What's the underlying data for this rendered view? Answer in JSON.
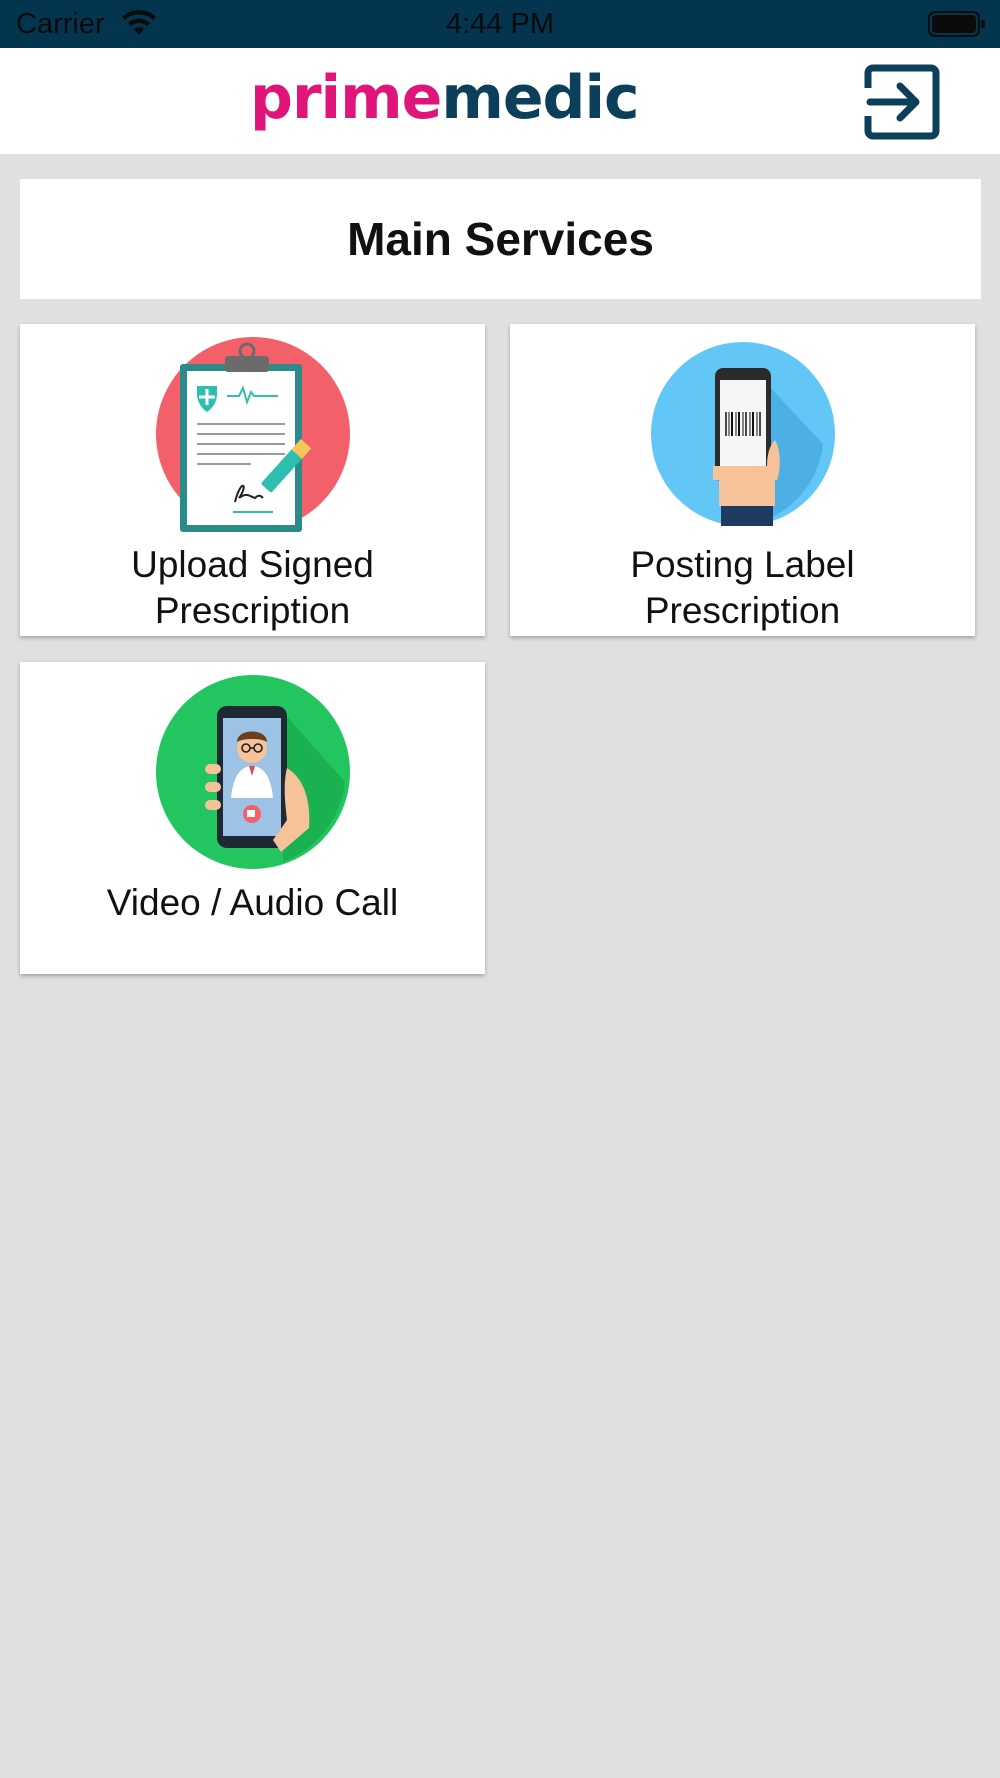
{
  "status_bar": {
    "carrier": "Carrier",
    "time": "4:44 PM",
    "wifi_icon": "wifi-icon",
    "battery_icon": "battery-icon"
  },
  "header": {
    "logo_prime": "prime",
    "logo_medic": "medic",
    "logout_icon": "logout-icon"
  },
  "main": {
    "title": "Main Services",
    "services": [
      {
        "label": "Upload Signed Prescription",
        "icon": "prescription-clipboard-icon",
        "color": "#f4606a"
      },
      {
        "label": "Posting Label Prescription",
        "icon": "phone-barcode-icon",
        "color": "#62c6f7"
      },
      {
        "label": "Video / Audio Call",
        "icon": "video-doctor-call-icon",
        "color": "#22c55e"
      }
    ]
  },
  "colors": {
    "status_bar": "#03354e",
    "brand_pink": "#e0157a",
    "brand_navy": "#0b3f5a",
    "background": "#e0e0e0"
  }
}
